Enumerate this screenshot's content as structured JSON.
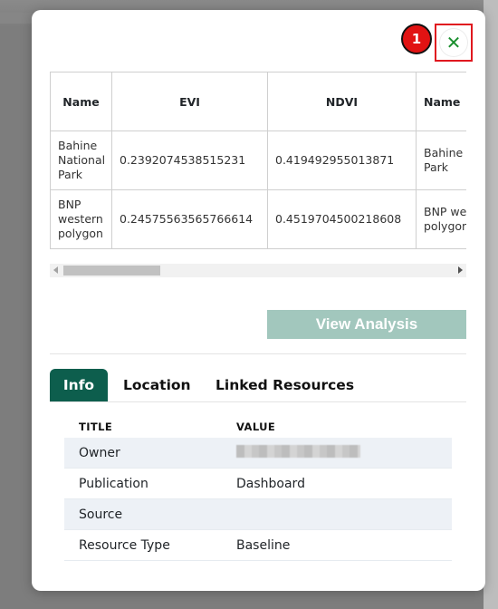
{
  "close_icon_glyph": "✕",
  "step_badge": "1",
  "table": {
    "headers": [
      "Name",
      "EVI",
      "NDVI",
      "Name"
    ],
    "rows": [
      [
        "Bahine National Park",
        "0.2392074538515231",
        "0.419492955013871",
        "Bahine National Park"
      ],
      [
        "BNP western polygon",
        "0.24575563565766614",
        "0.4519704500218608",
        "BNP western polygon"
      ]
    ]
  },
  "view_analysis_label": "View Analysis",
  "tabs": [
    {
      "label": "Info",
      "active": true
    },
    {
      "label": "Location",
      "active": false
    },
    {
      "label": "Linked Resources",
      "active": false
    }
  ],
  "info": {
    "title_header": "TITLE",
    "value_header": "VALUE",
    "rows": [
      {
        "title": "Owner",
        "value": "",
        "redacted": true
      },
      {
        "title": "Publication",
        "value": "Dashboard"
      },
      {
        "title": "Source",
        "value": ""
      },
      {
        "title": "Resource Type",
        "value": "Baseline"
      }
    ]
  },
  "colors": {
    "tab_active": "#0d5e4d",
    "view_button": "#a2c7bd",
    "close_icon": "#1a8f2e",
    "highlight_box": "#e0181f",
    "badge": "#e11313"
  }
}
